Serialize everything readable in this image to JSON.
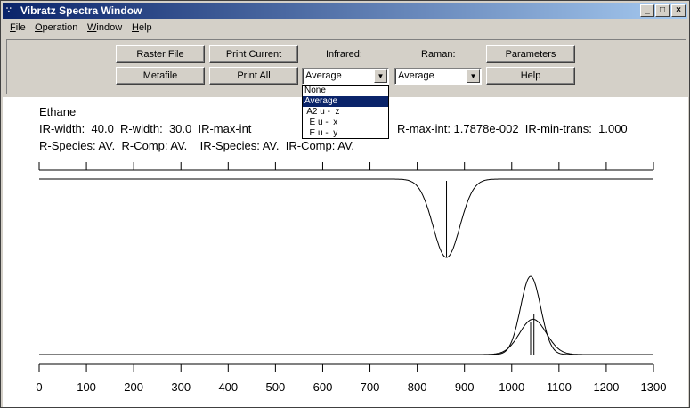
{
  "window": {
    "title": "Vibratz Spectra Window",
    "controls": {
      "minimize": "_",
      "maximize": "□",
      "close": "×"
    }
  },
  "menu": [
    {
      "label": "File",
      "key": "F",
      "rest": "ile"
    },
    {
      "label": "Operation",
      "key": "O",
      "rest": "peration"
    },
    {
      "label": "Window",
      "key": "W",
      "rest": "indow"
    },
    {
      "label": "Help",
      "key": "H",
      "rest": "elp"
    }
  ],
  "toolbar": {
    "raster_file": "Raster File",
    "metafile": "Metafile",
    "print_current": "Print Current",
    "print_all": "Print All",
    "infrared_label": "Infrared:",
    "raman_label": "Raman:",
    "parameters": "Parameters",
    "help": "Help",
    "infrared_value": "Average",
    "raman_value": "Average"
  },
  "infrared_dropdown": {
    "options": [
      "None",
      "Average",
      " A2 u -  z",
      "  E u -  x",
      "  E u -  y"
    ],
    "selected_index": 1
  },
  "info": {
    "molecule": "Ethane",
    "line1_left": "IR-width:  40.0  R-width:  30.0  IR-max-int",
    "line1_right": "R-max-int: 1.7878e-002  IR-min-trans:  1.000",
    "line2": "R-Species: AV.  R-Comp: AV.    IR-Species: AV.  IR-Comp: AV."
  },
  "chart_data": {
    "type": "line",
    "x_range": [
      0,
      1300
    ],
    "x_ticks": [
      0,
      100,
      200,
      300,
      400,
      500,
      600,
      700,
      800,
      900,
      1000,
      1100,
      1200,
      1300
    ],
    "ir_spectrum": {
      "baseline_transmittance": 1.0,
      "band_center": 862,
      "band_width": 40,
      "band_depth": 0.95,
      "stick_positions": [
        862
      ]
    },
    "raman_spectrum": {
      "bands": [
        {
          "center": 1040,
          "width": 30,
          "intensity": 1.0
        },
        {
          "center": 1045,
          "width": 40,
          "intensity": 0.45
        }
      ],
      "stick_positions": [
        1040,
        1047
      ]
    }
  }
}
